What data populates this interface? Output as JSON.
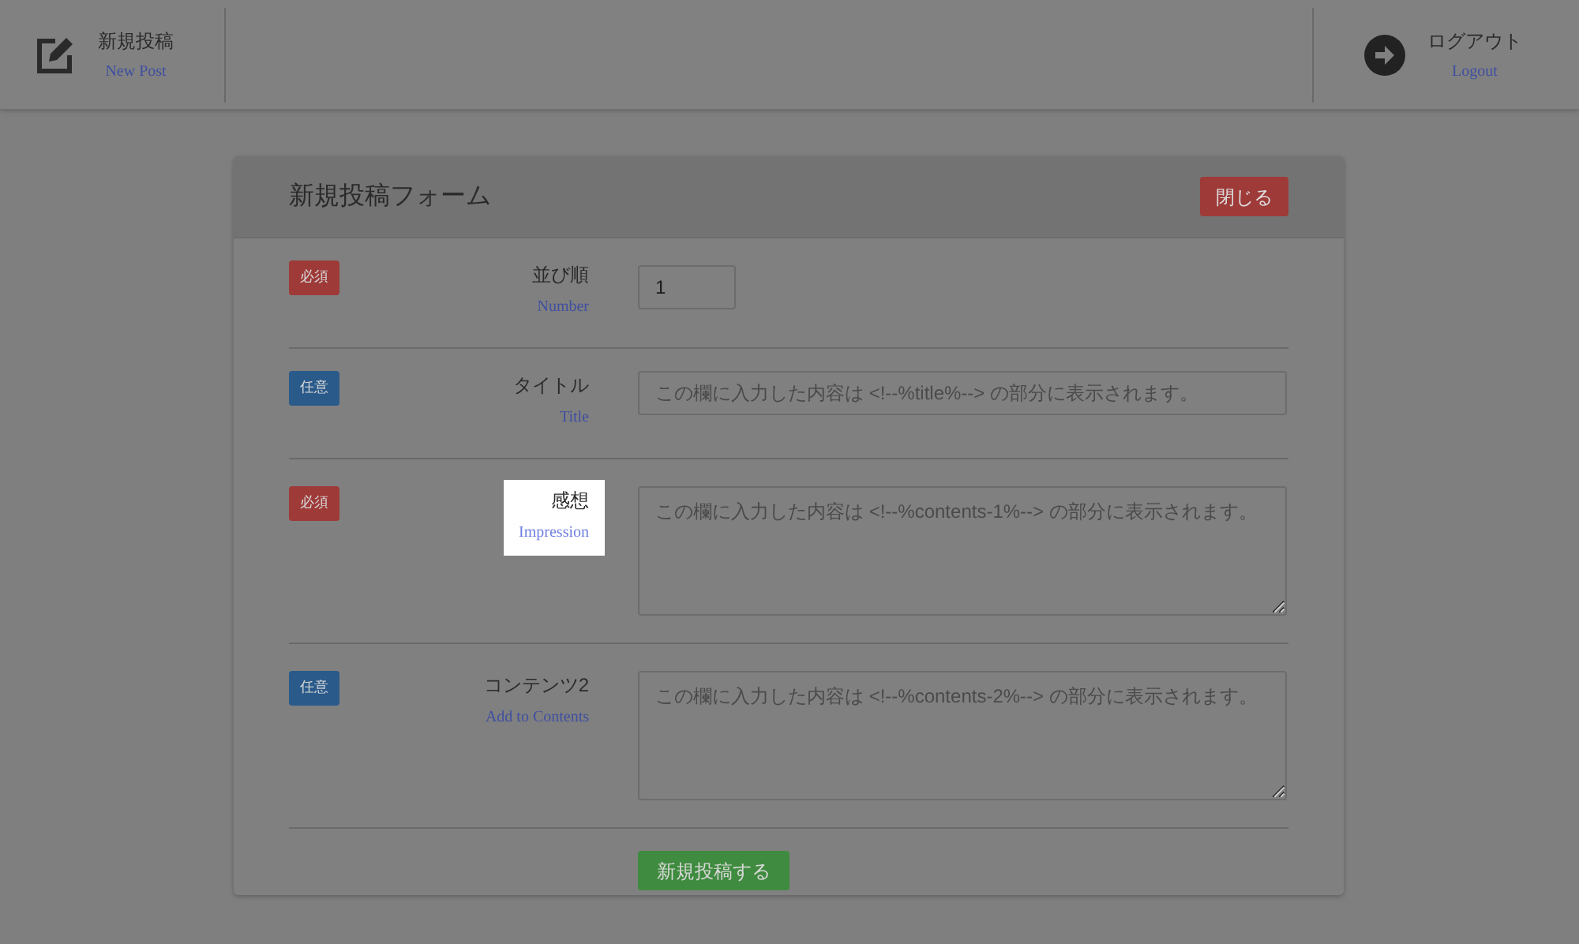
{
  "header": {
    "left": {
      "title": "新規投稿",
      "subtitle": "New Post"
    },
    "right": {
      "title": "ログアウト",
      "subtitle": "Logout"
    }
  },
  "form": {
    "title": "新規投稿フォーム",
    "close_button": "閉じる",
    "submit_button": "新規投稿する",
    "rows": [
      {
        "badge": "必須",
        "kind": "required",
        "label": "並び順",
        "sublabel": "Number",
        "highlighted": false,
        "field": {
          "kind": "number",
          "value": "1"
        }
      },
      {
        "badge": "任意",
        "kind": "optional",
        "label": "タイトル",
        "sublabel": "Title",
        "highlighted": false,
        "field": {
          "kind": "text",
          "placeholder": "この欄に入力した内容は <!--%title%--> の部分に表示されます。"
        }
      },
      {
        "badge": "必須",
        "kind": "required",
        "label": "感想",
        "sublabel": "Impression",
        "highlighted": true,
        "field": {
          "kind": "textarea",
          "placeholder": "この欄に入力した内容は <!--%contents-1%--> の部分に表示されます。"
        }
      },
      {
        "badge": "任意",
        "kind": "optional",
        "label": "コンテンツ2",
        "sublabel": "Add to Contents",
        "highlighted": false,
        "field": {
          "kind": "textarea",
          "placeholder": "この欄に入力した内容は <!--%contents-2%--> の部分に表示されます。"
        }
      }
    ]
  }
}
